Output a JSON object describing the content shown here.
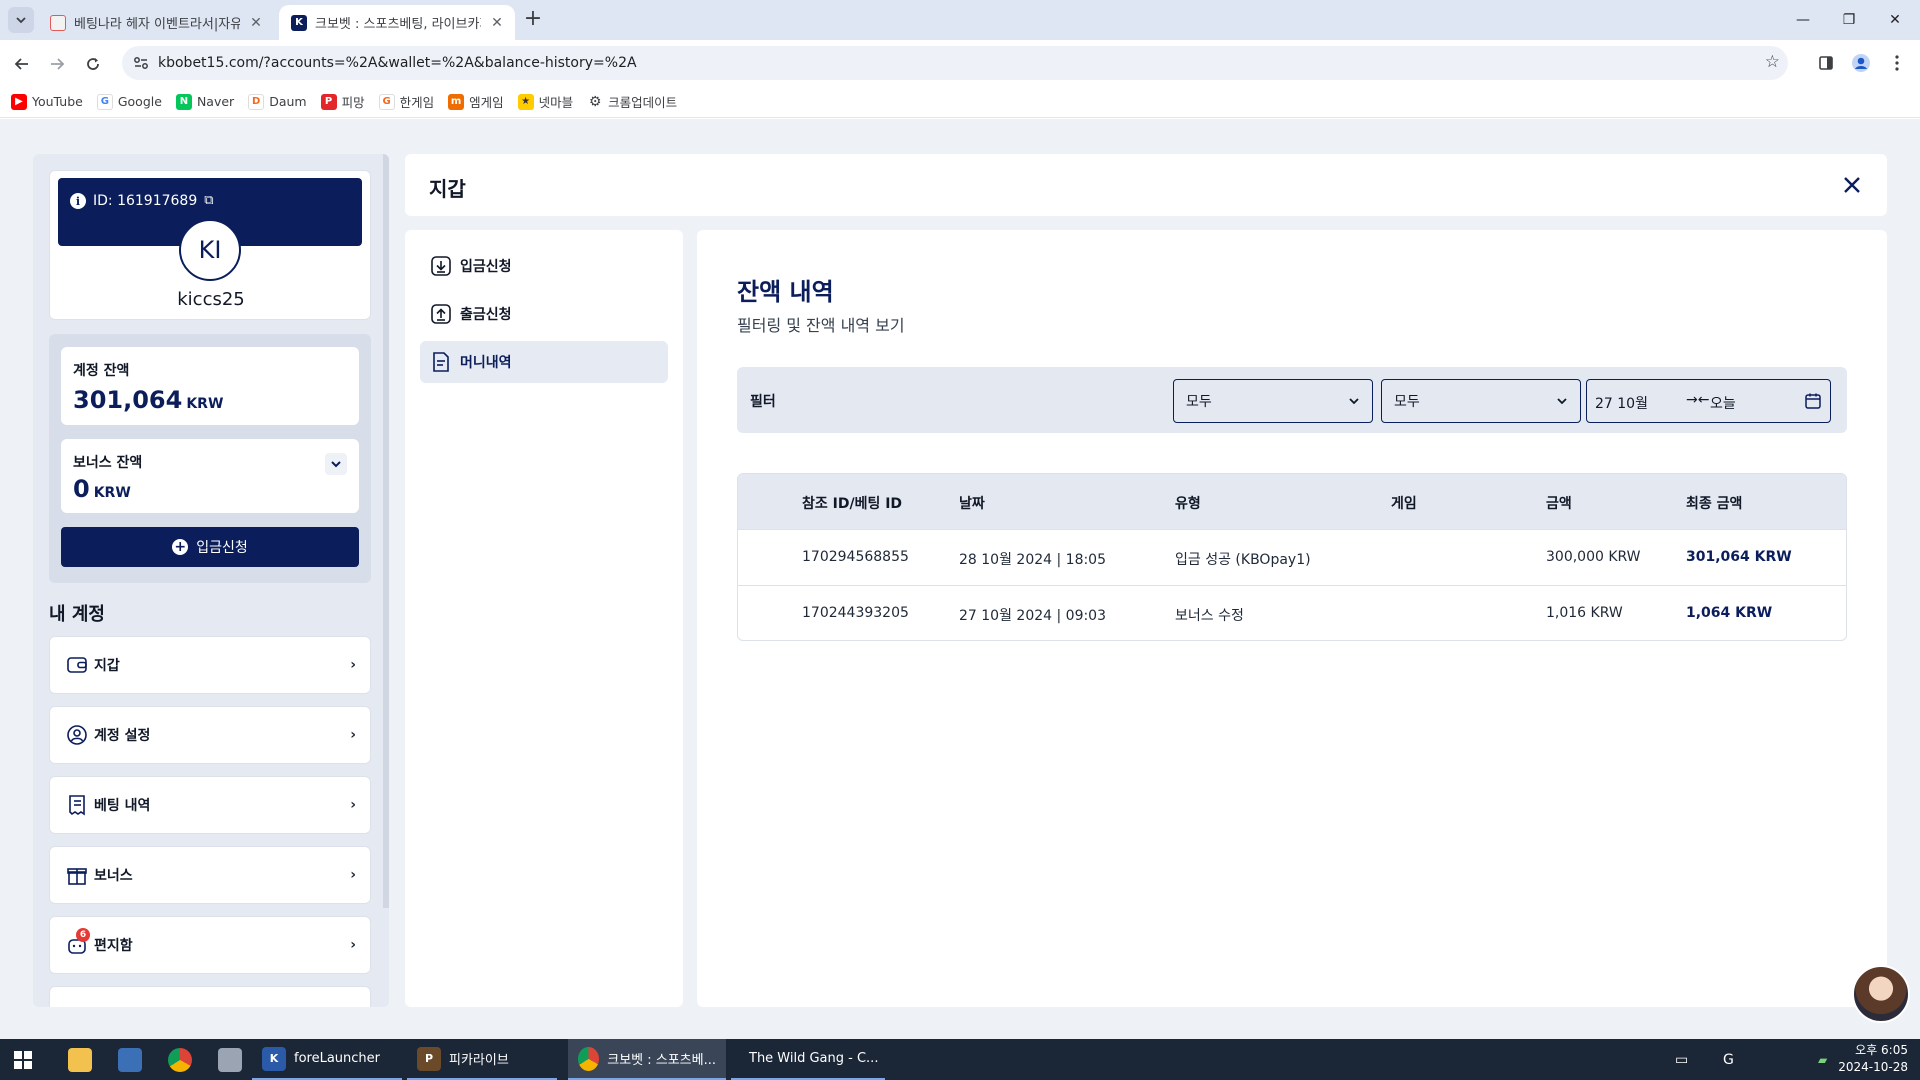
{
  "browser": {
    "tabs": [
      {
        "title": "베팅나라 헤자 이벤트라서|자유",
        "active": false
      },
      {
        "title": "크보벳 : 스포츠베팅, 라이브카지",
        "active": true
      }
    ],
    "url": "kbobet15.com/?accounts=%2A&wallet=%2A&balance-history=%2A",
    "bookmarks": [
      "YouTube",
      "Google",
      "Naver",
      "Daum",
      "피망",
      "한게임",
      "엠게임",
      "넷마블",
      "크롬업데이트"
    ]
  },
  "profile": {
    "id_label": "ID: 161917689",
    "initials": "KI",
    "username": "kiccs25"
  },
  "balance": {
    "account_label": "계정 잔액",
    "account_amount": "301,064",
    "account_currency": "KRW",
    "bonus_label": "보너스 잔액",
    "bonus_amount": "0",
    "bonus_currency": "KRW",
    "deposit_button": "입금신청"
  },
  "my_account": {
    "heading": "내 계정",
    "items": [
      {
        "label": "지갑",
        "icon": "wallet-icon"
      },
      {
        "label": "계정 설정",
        "icon": "user-circle-icon"
      },
      {
        "label": "베팅 내역",
        "icon": "receipt-icon"
      },
      {
        "label": "보너스",
        "icon": "gift-icon"
      },
      {
        "label": "편지함",
        "icon": "mail-icon",
        "badge": "6"
      }
    ]
  },
  "wallet": {
    "title": "지갑",
    "nav": [
      {
        "label": "입금신청",
        "icon": "download-icon"
      },
      {
        "label": "출금신청",
        "icon": "upload-icon"
      },
      {
        "label": "머니내역",
        "icon": "document-icon",
        "active": true
      }
    ]
  },
  "history": {
    "title": "잔액 내역",
    "subtitle": "필터링 및 잔액 내역 보기",
    "filter_label": "필터",
    "filter_select_1": "모두",
    "filter_select_2": "모두",
    "date_from": "27 10월",
    "date_to": "오늘",
    "columns": [
      "참조 ID/베팅 ID",
      "날짜",
      "유형",
      "게임",
      "금액",
      "최종 금액"
    ],
    "rows": [
      {
        "ref": "170294568855",
        "date": "28 10월 2024 | 18:05",
        "type": "입금 성공 (KBOpay1)",
        "game": "",
        "amount": "300,000 KRW",
        "final": "301,064 KRW"
      },
      {
        "ref": "170244393205",
        "date": "27 10월 2024 | 09:03",
        "type": "보너스 수정",
        "game": "",
        "amount": "1,016 KRW",
        "final": "1,064 KRW"
      }
    ]
  },
  "taskbar": {
    "apps": [
      "foreLauncher",
      "피카라이브",
      "크보벳 : 스포츠베...",
      "The Wild Gang - C..."
    ],
    "time": "오후 6:05",
    "date": "2024-10-28"
  },
  "colors": {
    "brand": "#0b1e5b",
    "page_bg": "#eef1f6",
    "badge": "#e53935"
  }
}
